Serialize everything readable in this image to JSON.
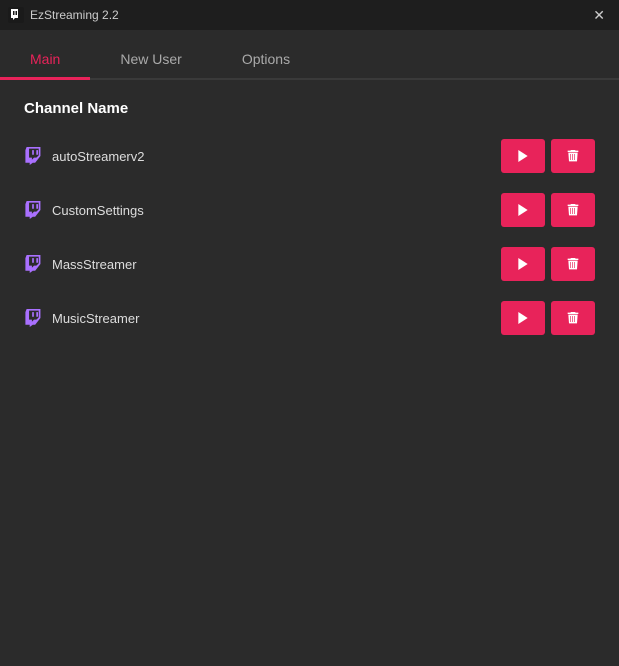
{
  "window": {
    "title": "EzStreaming 2.2",
    "close_label": "✕"
  },
  "tabs": [
    {
      "id": "main",
      "label": "Main",
      "active": true
    },
    {
      "id": "new-user",
      "label": "New User",
      "active": false
    },
    {
      "id": "options",
      "label": "Options",
      "active": false
    }
  ],
  "main": {
    "column_header": "Channel Name",
    "users": [
      {
        "name": "autoStreamerv2"
      },
      {
        "name": "CustomSettings"
      },
      {
        "name": "MassStreamer"
      },
      {
        "name": "MusicStreamer"
      }
    ]
  },
  "actions": {
    "play_label": "play",
    "delete_label": "delete"
  },
  "colors": {
    "accent": "#e8235a",
    "active_tab": "#e8235a",
    "bg": "#2b2b2b",
    "title_bg": "#1e1e1e"
  }
}
